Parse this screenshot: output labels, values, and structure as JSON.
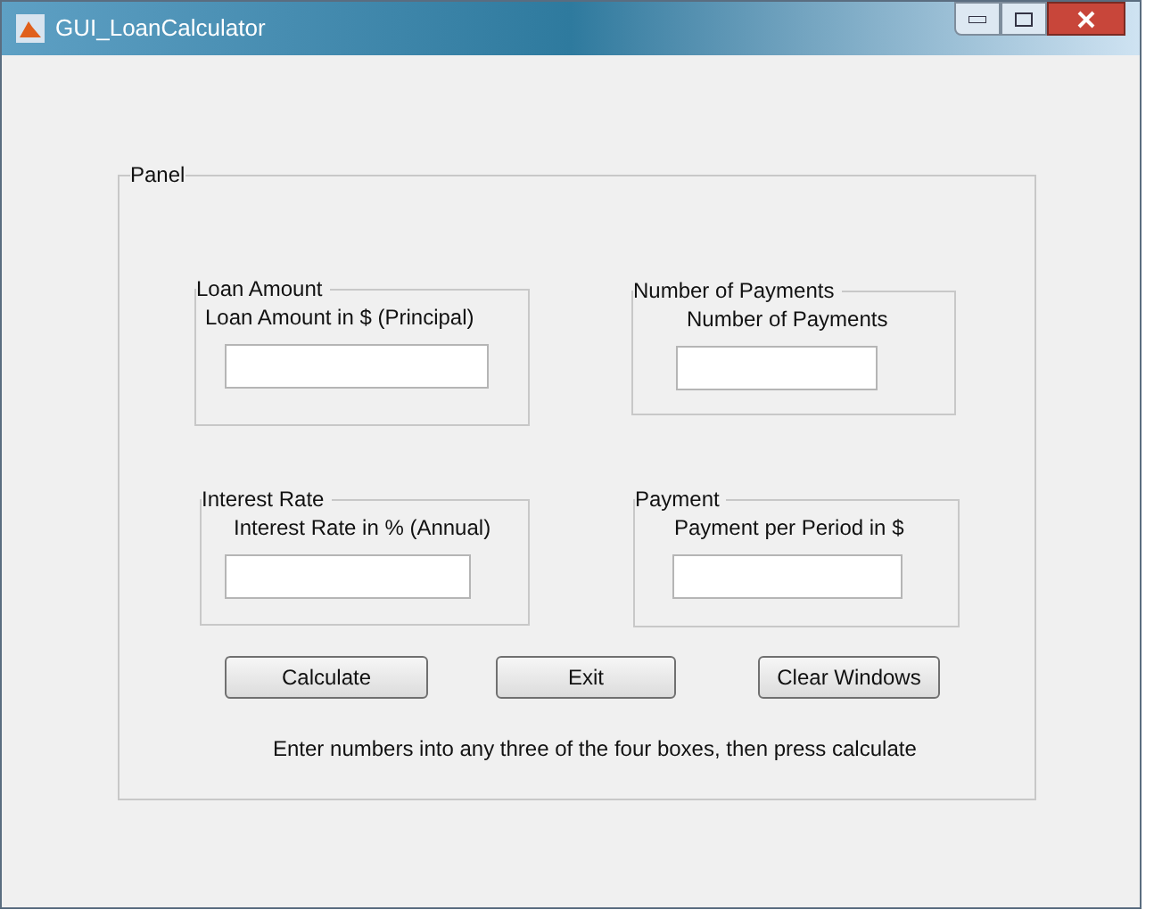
{
  "window": {
    "title": "GUI_LoanCalculator"
  },
  "panel": {
    "title": "Panel",
    "groups": [
      {
        "title": "Loan Amount",
        "label": "Loan Amount in $ (Principal)"
      },
      {
        "title": "Number of Payments",
        "label": "Number of Payments"
      },
      {
        "title": "Interest Rate",
        "label": "Interest Rate in % (Annual)"
      },
      {
        "title": "Payment",
        "label": "Payment per Period in $"
      }
    ],
    "buttons": [
      "Calculate",
      "Exit",
      "Clear Windows"
    ],
    "message": "Enter numbers into any three of the four boxes, then press calculate"
  }
}
